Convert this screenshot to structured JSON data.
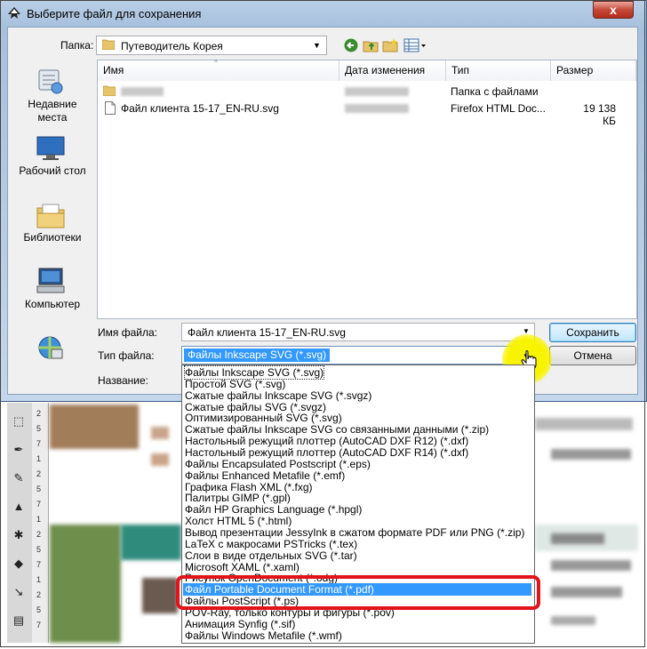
{
  "window": {
    "title": "Выберите файл для сохранения",
    "close_label": "x"
  },
  "folder_bar": {
    "label": "Папка:",
    "current_folder": "Путеводитель Корея"
  },
  "places": [
    {
      "label_line1": "Недавние",
      "label_line2": "места",
      "icon": "recent-places-icon"
    },
    {
      "label_line1": "Рабочий стол",
      "label_line2": "",
      "icon": "desktop-icon"
    },
    {
      "label_line1": "Библиотеки",
      "label_line2": "",
      "icon": "libraries-icon"
    },
    {
      "label_line1": "Компьютер",
      "label_line2": "",
      "icon": "computer-icon"
    },
    {
      "label_line1": "",
      "label_line2": "",
      "icon": "network-icon"
    }
  ],
  "file_list": {
    "columns": [
      "Имя",
      "Дата изменения",
      "Тип",
      "Размер"
    ],
    "rows": [
      {
        "name": "",
        "date": "",
        "type": "Папка с файлами",
        "size": ""
      },
      {
        "name": "Файл клиента 15-17_EN-RU.svg",
        "date": "",
        "type": "Firefox HTML Doc...",
        "size": "19 138 КБ"
      }
    ]
  },
  "form": {
    "filename_label": "Имя файла:",
    "filename_value": "Файл клиента 15-17_EN-RU.svg",
    "filetype_label": "Тип файла:",
    "filetype_value": "Файлы Inkscape SVG (*.svg)",
    "title_label": "Название:",
    "save_label": "Сохранить",
    "cancel_label": "Отмена"
  },
  "filetype_options": [
    "Файлы Inkscape SVG (*.svg)",
    "Простой SVG (*.svg)",
    "Сжатые файлы Inkscape SVG (*.svgz)",
    "Сжатые файлы SVG (*.svgz)",
    "Оптимизированный SVG (*.svg)",
    "Сжатые файлы Inkscape SVG со связанными данными (*.zip)",
    "Настольный режущий плоттер (AutoCAD DXF R12) (*.dxf)",
    "Настольный режущий плоттер (AutoCAD DXF R14) (*.dxf)",
    "Файлы Encapsulated Postscript (*.eps)",
    "Файлы Enhanced Metafile (*.emf)",
    "Графика Flash XML (*.fxg)",
    "Палитры GIMP (*.gpl)",
    "Файл HP Graphics Language (*.hpgl)",
    "Холст HTML 5 (*.html)",
    "Вывод презентации JessyInk в сжатом формате PDF или PNG (*.zip)",
    "LaTeX с макросами PSTricks (*.tex)",
    "Слои в виде отдельных SVG (*.tar)",
    "Microsoft XAML (*.xaml)",
    "Рисунок OpenDocument (*.odg)",
    "Файл Portable Document Format (*.pdf)",
    "Файлы PostScript (*.ps)",
    "POV-Ray, только контуры и фигуры (*.pov)",
    "Анимация Synfig (*.sif)",
    "Файлы Windows Metafile (*.wmf)"
  ],
  "highlighted_option_index": 19,
  "colors": {
    "selection": "#3399ff",
    "annotation_red": "#e3131b",
    "annotation_yellow": "#f8f400"
  },
  "ruler_ticks": [
    "2",
    "5",
    "7",
    "1",
    "2",
    "5",
    "7",
    "1",
    "2",
    "5",
    "7",
    "1",
    "2",
    "5",
    "7"
  ]
}
